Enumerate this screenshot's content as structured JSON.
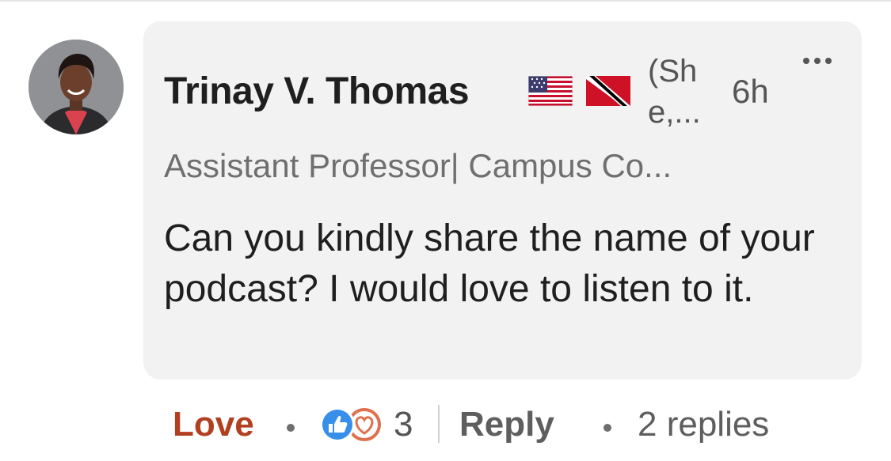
{
  "comment": {
    "author": {
      "name": "Trinay V. Thomas",
      "flags": [
        "us-flag-icon",
        "trinidad-tobago-flag-icon"
      ],
      "pronouns": "(She,...",
      "pronouns_line1": "(Sh",
      "pronouns_line2": "e,...",
      "headline": "Assistant Professor| Campus Co..."
    },
    "time": "6h",
    "text": "Can you kindly share the name of your podcast? I would love to listen to it.",
    "more_icon": "more-options-icon"
  },
  "actions": {
    "love_label": "Love",
    "reaction_icons": [
      "like-icon",
      "love-icon"
    ],
    "reaction_count": "3",
    "reply_label": "Reply",
    "replies_label": "2 replies"
  },
  "colors": {
    "bubble": "#f2f2f2",
    "love_text": "#b24020",
    "secondary_text": "#6f6f6f",
    "primary_text": "#1f1f1f",
    "like_blue": "#378fe9",
    "love_red": "#df704d"
  }
}
